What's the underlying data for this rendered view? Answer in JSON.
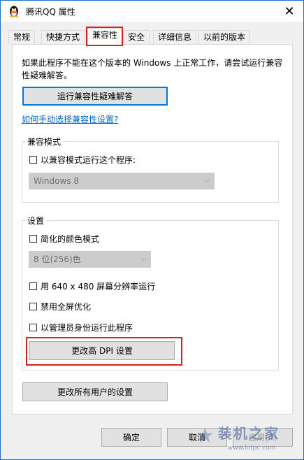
{
  "window": {
    "title": "腾讯QQ 属性",
    "close_icon": "close-icon",
    "app_icon": "qq-penguin-icon"
  },
  "tabs": [
    {
      "label": "常规"
    },
    {
      "label": "快捷方式"
    },
    {
      "label": "兼容性",
      "active": true
    },
    {
      "label": "安全"
    },
    {
      "label": "详细信息"
    },
    {
      "label": "以前的版本"
    }
  ],
  "compat": {
    "info_text": "如果此程序不能在这个版本的 Windows 上正常工作，请尝试运行兼容性疑难解答。",
    "troubleshoot_button": "运行兼容性疑难解答",
    "manual_link": "如何手动选择兼容性设置?",
    "mode_group": {
      "label": "兼容模式",
      "checkbox_label": "以兼容模式运行这个程序:",
      "select_value": "Windows 8"
    },
    "settings_group": {
      "label": "设置",
      "reduced_color_label": "简化的颜色模式",
      "color_select_value": "8 位(256)色",
      "res_640_label": "用 640 x 480 屏幕分辨率运行",
      "disable_fullscreen_label": "禁用全屏优化",
      "run_as_admin_label": "以管理员身份运行此程序",
      "dpi_button": "更改高 DPI 设置"
    },
    "all_users_button": "更改所有用户的设置"
  },
  "footer": {
    "ok_label": "确定",
    "cancel_label": "取消",
    "apply_label": "应用(A)"
  },
  "watermark": {
    "text": "装机之家",
    "url": "www.lotpc.com"
  },
  "colors": {
    "highlight_red": "#d81e1e",
    "link_blue": "#0066cc",
    "focus_blue": "#0078d7"
  }
}
